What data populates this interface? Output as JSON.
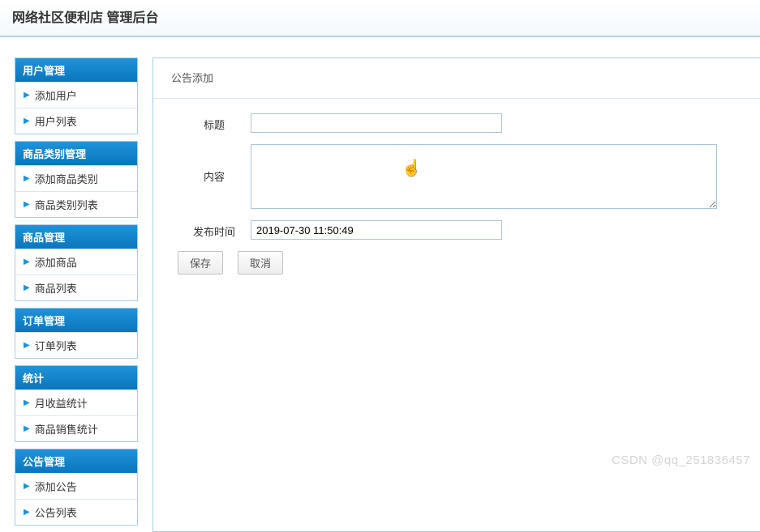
{
  "header": {
    "title": "网络社区便利店 管理后台"
  },
  "sidebar": {
    "groups": [
      {
        "title": "用户管理",
        "items": [
          "添加用户",
          "用户列表"
        ]
      },
      {
        "title": "商品类别管理",
        "items": [
          "添加商品类别",
          "商品类别列表"
        ]
      },
      {
        "title": "商品管理",
        "items": [
          "添加商品",
          "商品列表"
        ]
      },
      {
        "title": "订单管理",
        "items": [
          "订单列表"
        ]
      },
      {
        "title": "统计",
        "items": [
          "月收益统计",
          "商品销售统计"
        ]
      },
      {
        "title": "公告管理",
        "items": [
          "添加公告",
          "公告列表"
        ]
      }
    ]
  },
  "main": {
    "panel_title": "公告添加",
    "form": {
      "title_label": "标题",
      "title_value": "",
      "content_label": "内容",
      "content_value": "",
      "publish_label": "发布时间",
      "publish_value": "2019-07-30 11:50:49"
    },
    "buttons": {
      "save": "保存",
      "cancel": "取消"
    }
  },
  "watermark": "CSDN @qq_251836457"
}
